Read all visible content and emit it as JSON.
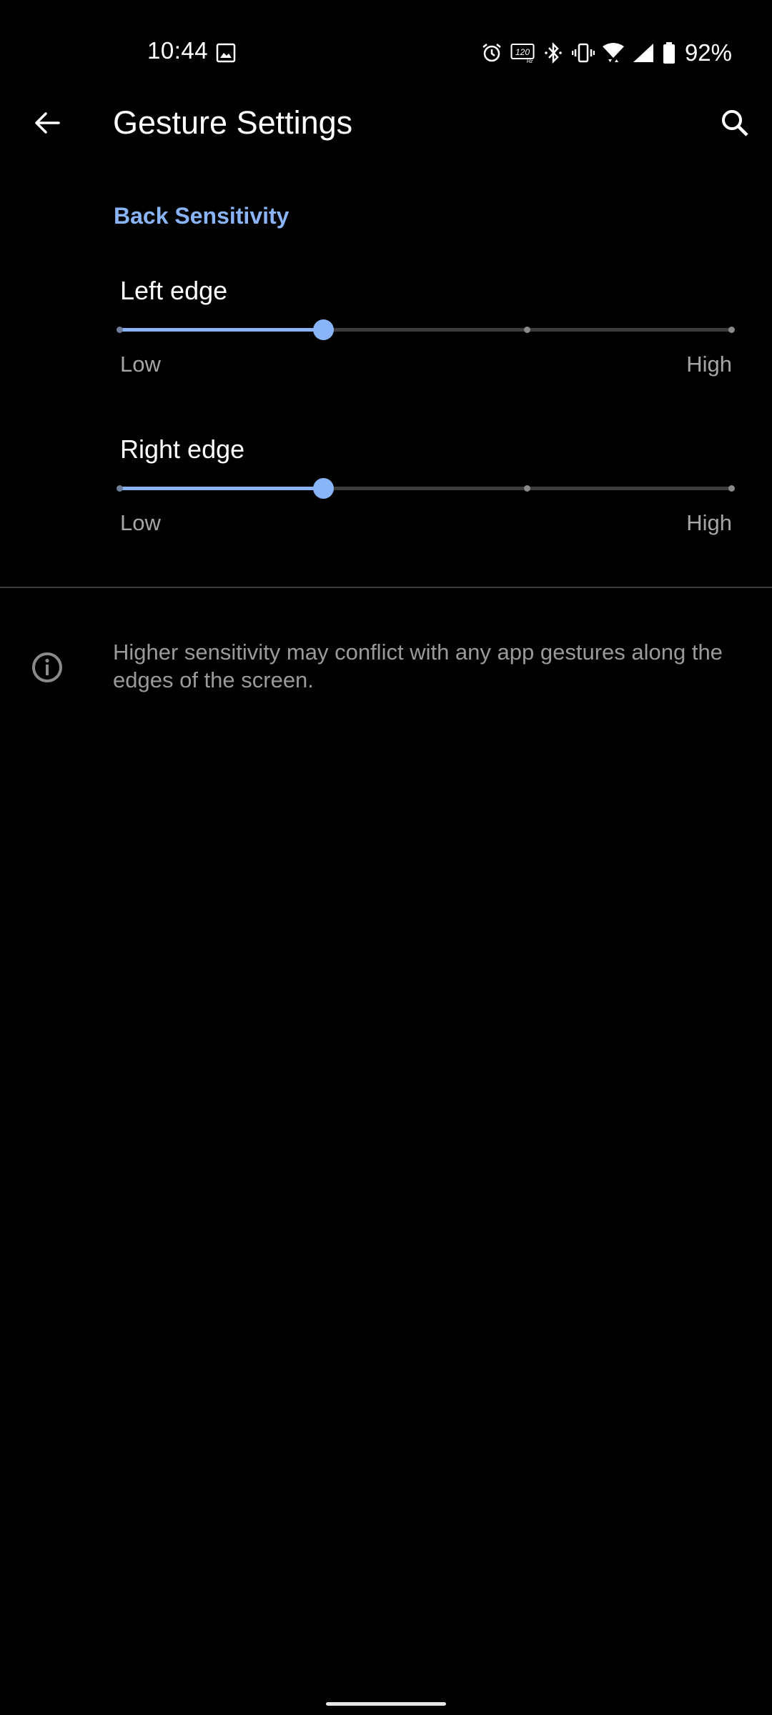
{
  "status_bar": {
    "time": "10:44",
    "left_icons": [
      "gallery-image-icon"
    ],
    "right_icons": [
      "alarm-icon",
      "refresh-rate-120hz-icon",
      "bluetooth-icon",
      "vibrate-icon",
      "wifi-icon",
      "cellular-signal-icon",
      "battery-icon"
    ],
    "refresh_rate_label": "120",
    "refresh_rate_unit": "Hz",
    "battery_percent": "92%"
  },
  "app_bar": {
    "title": "Gesture Settings",
    "back_icon": "arrow-back-icon",
    "search_icon": "search-icon"
  },
  "section": {
    "header": "Back Sensitivity",
    "accent_color": "#8ab4f8"
  },
  "sliders": [
    {
      "title": "Left edge",
      "min_label": "Low",
      "max_label": "High",
      "steps": 4,
      "value_index": 1
    },
    {
      "title": "Right edge",
      "min_label": "Low",
      "max_label": "High",
      "steps": 4,
      "value_index": 1
    }
  ],
  "footer": {
    "icon": "info-icon",
    "text": "Higher sensitivity may conflict with any app gestures along the edges of the screen."
  }
}
